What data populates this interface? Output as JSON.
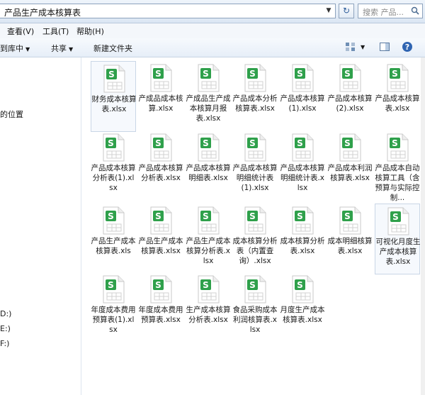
{
  "address": {
    "path": "产品生产成本核算表",
    "search_placeholder": "搜索 产品..."
  },
  "menu": [
    "查看(V)",
    "工具(T)",
    "帮助(H)"
  ],
  "toolbar": {
    "include_library": "包含到库中",
    "share": "共享",
    "new_folder": "新建文件夹"
  },
  "sidebar": [
    "的位置",
    "D:)",
    "E:)",
    "F:)"
  ],
  "colors": {
    "excel_green": "#2fa04b"
  },
  "files": [
    "财务成本核算表.xlsx",
    "产成品成本核算.xlsx",
    "产成品生产成本核算月报表.xlsx",
    "产品成本分析核算表.xlsx",
    "产品成本核算(1).xlsx",
    "产品成本核算(2).xlsx",
    "产品成本核算表.xlsx",
    "产品成本核算分析表(1).xlsx",
    "产品成本核算分析表.xlsx",
    "产品成本核算明细表.xlsx",
    "产品成本核算明细统计表 (1).xlsx",
    "产品成本核算明细统计表.xlsx",
    "产品成本利润核算表.xlsx",
    "产品成本自动核算工具（含预算与实际控制...",
    "产品生产成本核算表.xls",
    "产品生产成本核算表.xlsx",
    "产品生产成本核算分析表.xlsx",
    "成本核算分析表（内置查询）.xlsx",
    "成本核算分析表.xlsx",
    "成本明细核算表.xlsx",
    "可视化月度生产成本核算表.xlsx",
    "年度成本费用预算表(1).xlsx",
    "年度成本费用预算表.xlsx",
    "生产成本核算分析表.xlsx",
    "食品采购成本利润核算表.xlsx",
    "月度生产成本核算表.xlsx"
  ]
}
